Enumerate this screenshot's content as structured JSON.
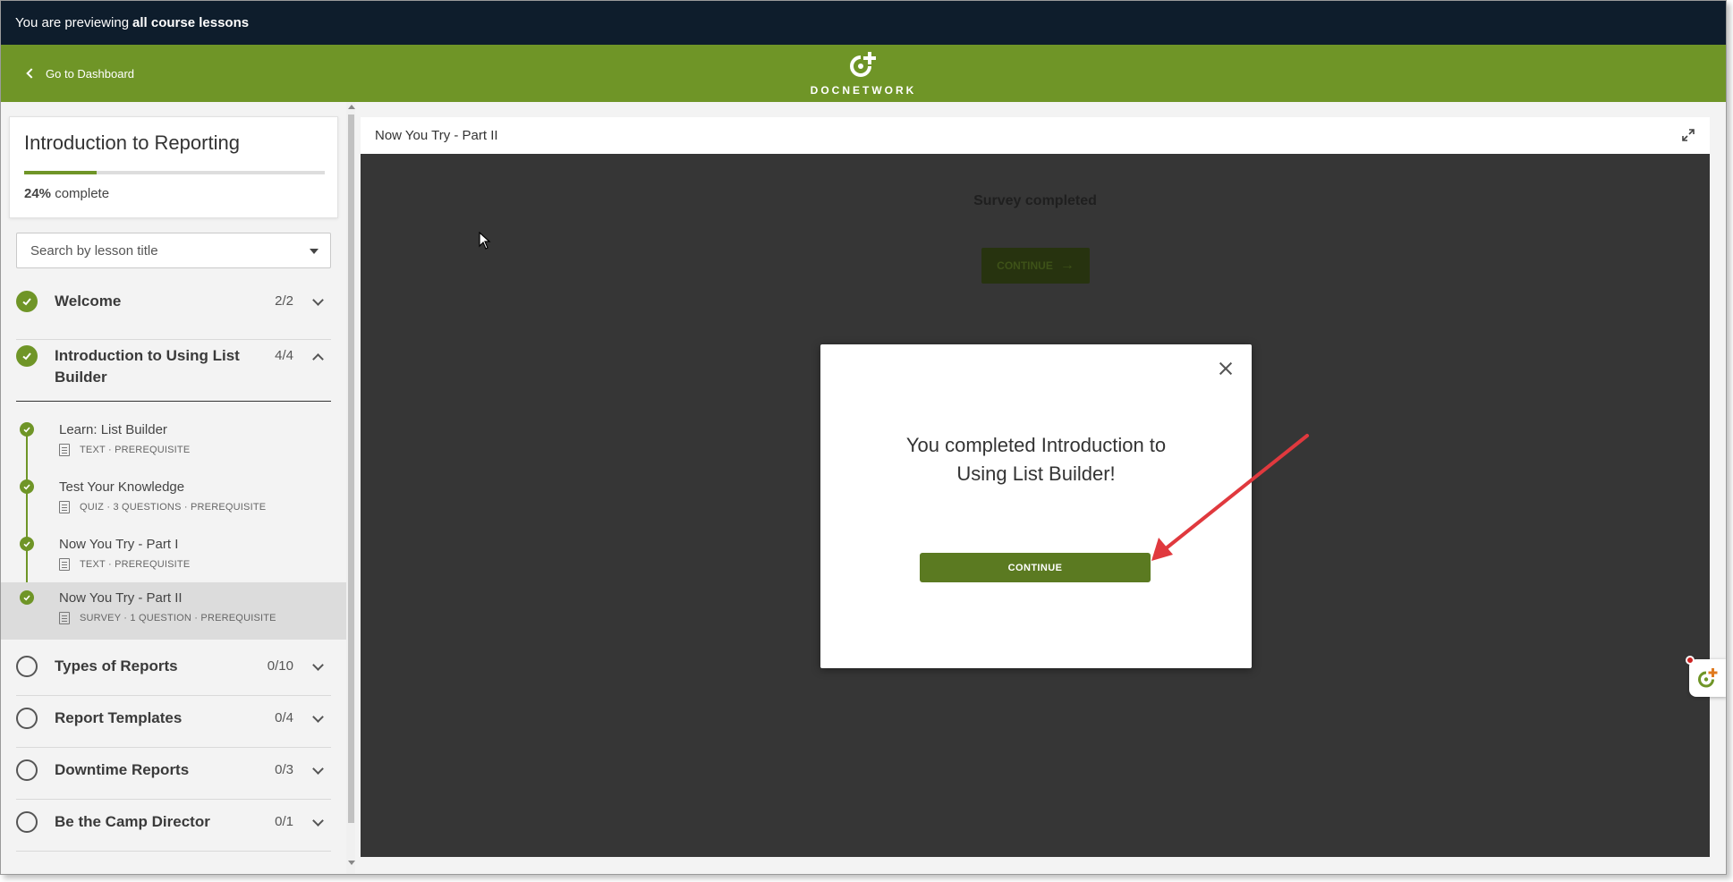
{
  "preview_bar": {
    "prefix": "You are previewing",
    "emphasis": "all course lessons"
  },
  "header": {
    "back_label": "Go to Dashboard",
    "logo_text": "DOCNETWORK",
    "brand_color": "#6f9527"
  },
  "course": {
    "title": "Introduction to Reporting",
    "progress_percent": 24,
    "progress_percent_label": "24%",
    "progress_suffix": "complete"
  },
  "search": {
    "placeholder": "Search by lesson title"
  },
  "sections": [
    {
      "title": "Welcome",
      "count": "2/2",
      "status": "complete",
      "expanded": false
    },
    {
      "title": "Introduction to Using List Builder",
      "count": "4/4",
      "status": "complete",
      "expanded": true
    },
    {
      "title": "Types of Reports",
      "count": "0/10",
      "status": "incomplete",
      "expanded": false
    },
    {
      "title": "Report Templates",
      "count": "0/4",
      "status": "incomplete",
      "expanded": false
    },
    {
      "title": "Downtime Reports",
      "count": "0/3",
      "status": "incomplete",
      "expanded": false
    },
    {
      "title": "Be the Camp Director",
      "count": "0/1",
      "status": "incomplete",
      "expanded": false
    }
  ],
  "lessons": [
    {
      "title": "Learn: List Builder",
      "meta": "TEXT · PREREQUISITE",
      "icon": "text-doc-icon",
      "status": "complete",
      "active": false
    },
    {
      "title": "Test Your Knowledge",
      "meta": "QUIZ · 3 QUESTIONS · PREREQUISITE",
      "icon": "quiz-icon",
      "status": "complete",
      "active": false
    },
    {
      "title": "Now You Try - Part I",
      "meta": "TEXT · PREREQUISITE",
      "icon": "text-doc-icon",
      "status": "complete",
      "active": false
    },
    {
      "title": "Now You Try - Part II",
      "meta": "SURVEY · 1 QUESTION · PREREQUISITE",
      "icon": "survey-icon",
      "status": "complete",
      "active": true
    }
  ],
  "content": {
    "lesson_title": "Now You Try - Part II",
    "background_status": "Survey completed",
    "background_button": "CONTINUE"
  },
  "modal": {
    "message": "You completed Introduction to Using List Builder!",
    "button_label": "CONTINUE"
  }
}
